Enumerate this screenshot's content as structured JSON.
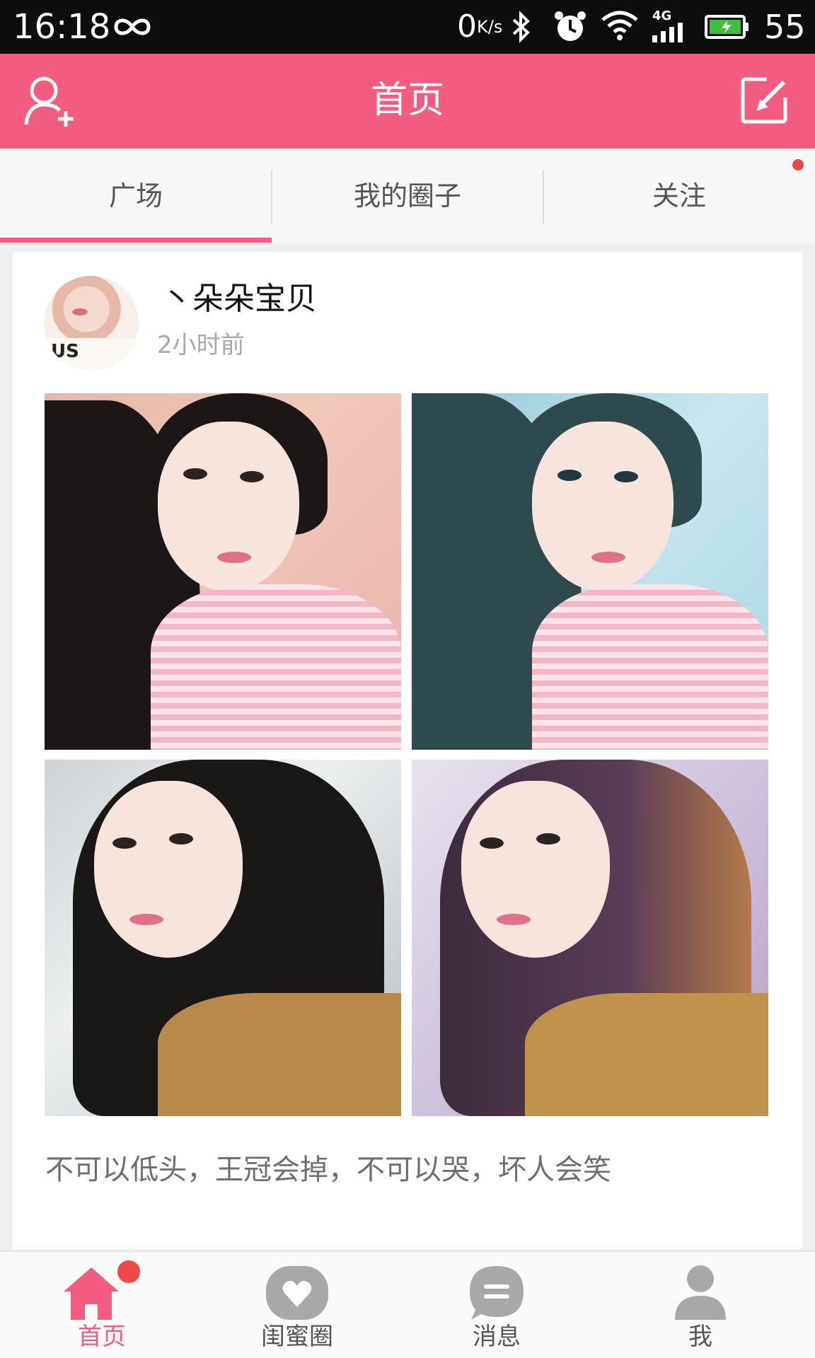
{
  "status_bar": {
    "time": "16:18",
    "net_speed_value": "0",
    "net_speed_unit": "K/s",
    "network_type": "4G",
    "battery_level": "55",
    "icons": [
      "infinity-icon",
      "bluetooth-icon",
      "alarm-icon",
      "wifi-icon",
      "signal-icon",
      "battery-icon"
    ]
  },
  "header": {
    "title": "首页",
    "left_icon": "add-friend-icon",
    "right_icon": "compose-icon"
  },
  "tabs": {
    "items": [
      {
        "label": "广场",
        "active": true
      },
      {
        "label": "我的圈子",
        "active": false
      },
      {
        "label": "关注",
        "active": false
      }
    ],
    "notification_dot": true
  },
  "post": {
    "username": "丶朵朵宝贝",
    "avatar_text": "US",
    "time": "2小时前",
    "photos": [
      {
        "name": "photo-1"
      },
      {
        "name": "photo-2"
      },
      {
        "name": "photo-3"
      },
      {
        "name": "photo-4"
      }
    ],
    "caption": "不可以低头，王冠会掉，不可以哭，坏人会笑"
  },
  "bottom_nav": {
    "items": [
      {
        "label": "首页",
        "icon": "home-icon",
        "active": true,
        "badge": true
      },
      {
        "label": "闺蜜圈",
        "icon": "heart-icon",
        "active": false
      },
      {
        "label": "消息",
        "icon": "message-icon",
        "active": false
      },
      {
        "label": "我",
        "icon": "person-icon",
        "active": false
      }
    ]
  },
  "colors": {
    "accent": "#f25c80",
    "badge": "#f0474a",
    "inactive_icon": "#a8a8a8"
  }
}
